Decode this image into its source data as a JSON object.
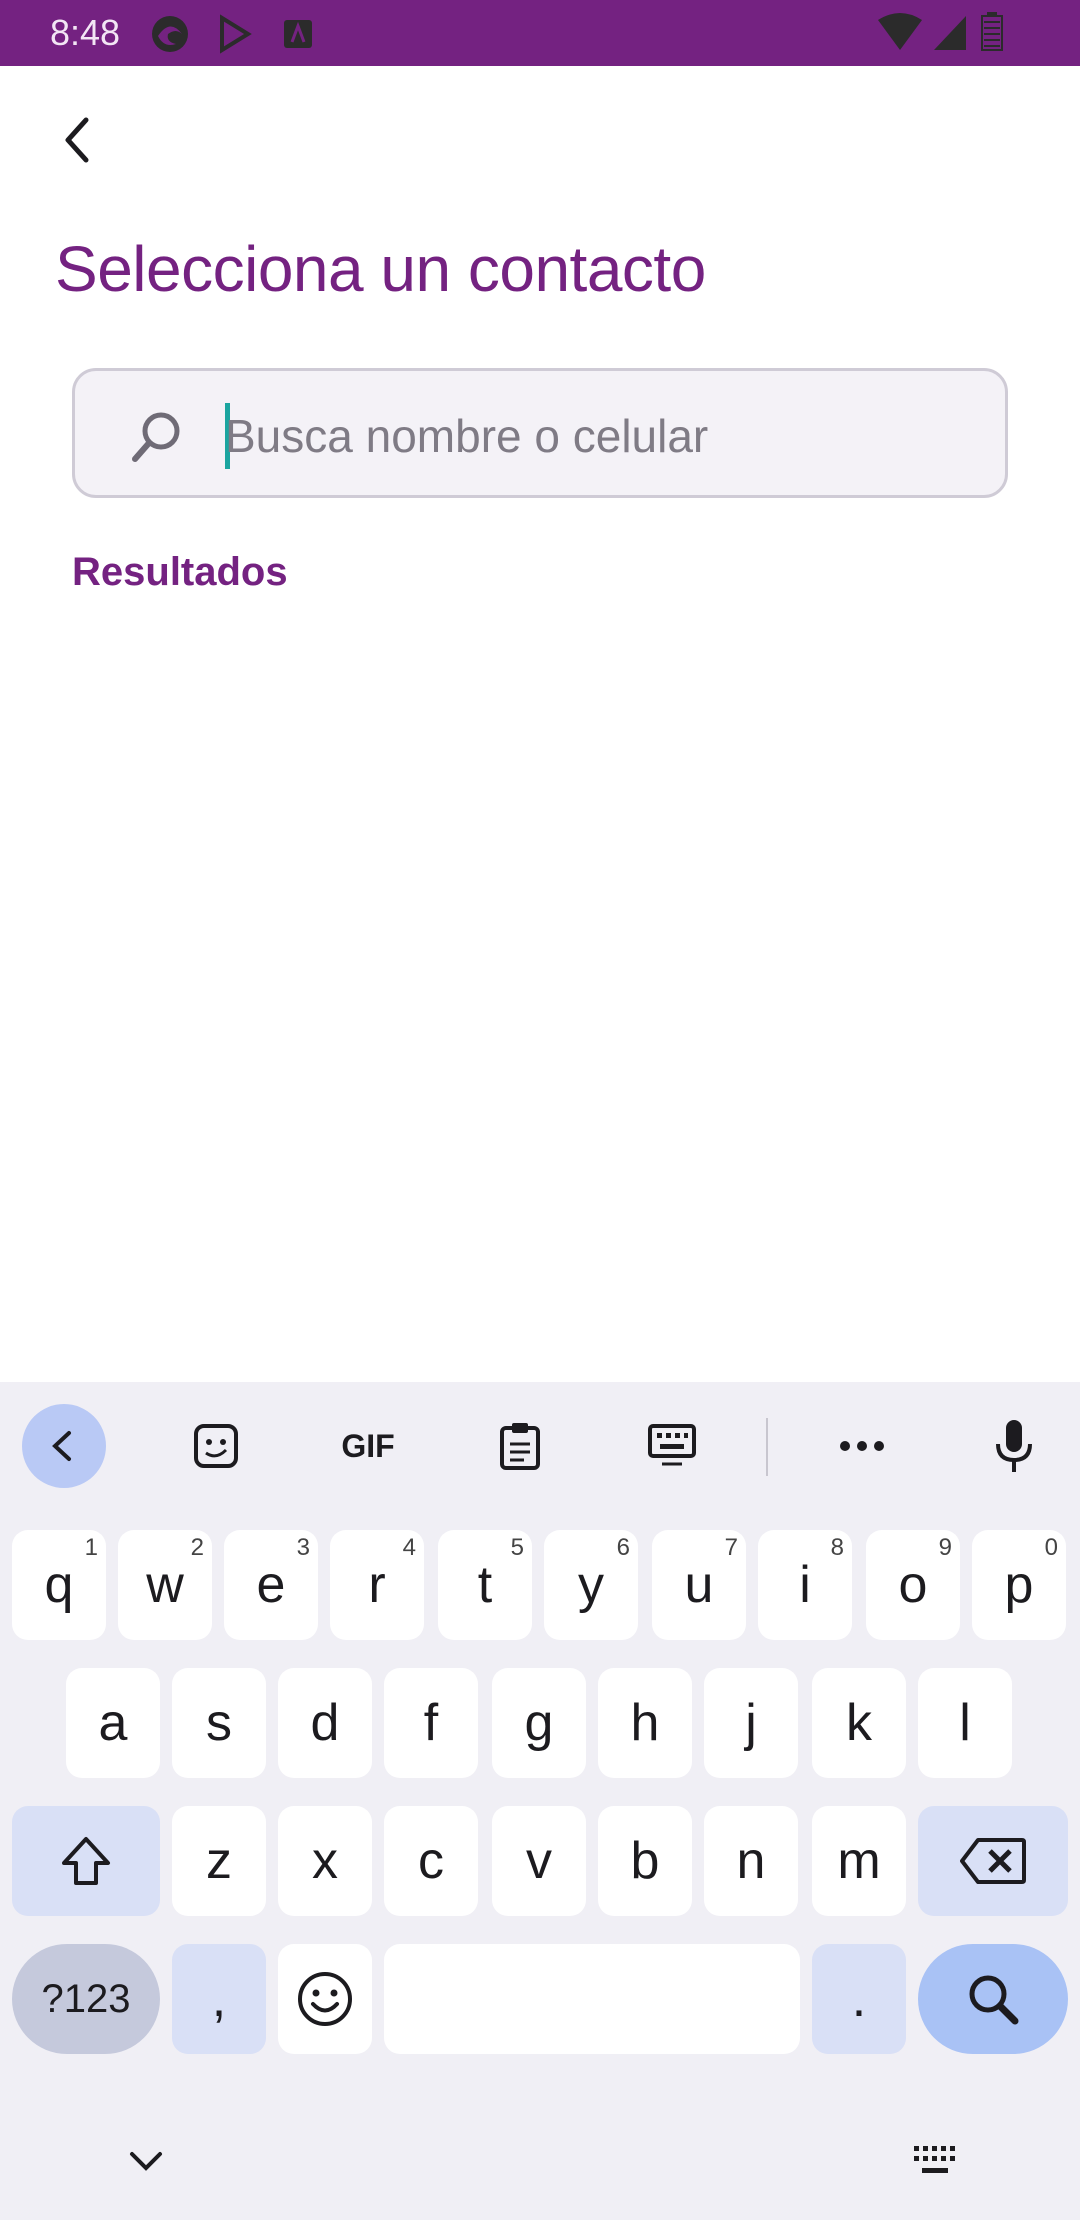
{
  "status_bar": {
    "time": "8:48",
    "icons_left": [
      "edge-icon",
      "play-store-icon",
      "app-icon"
    ],
    "icons_right": [
      "wifi-icon",
      "signal-icon",
      "battery-icon"
    ],
    "background": "#742281"
  },
  "header": {
    "back_icon": "chevron-left-icon",
    "title": "Selecciona un contacto"
  },
  "search": {
    "placeholder": "Busca nombre o celular",
    "value": "",
    "icon": "search-icon"
  },
  "results": {
    "label": "Resultados",
    "items": []
  },
  "keyboard": {
    "toolbar": [
      "back-arrow-icon",
      "sticker-icon",
      "gif-icon",
      "clipboard-icon",
      "keyboard-icon",
      "more-icon",
      "mic-icon"
    ],
    "row1": [
      {
        "label": "q",
        "hint": "1"
      },
      {
        "label": "w",
        "hint": "2"
      },
      {
        "label": "e",
        "hint": "3"
      },
      {
        "label": "r",
        "hint": "4"
      },
      {
        "label": "t",
        "hint": "5"
      },
      {
        "label": "y",
        "hint": "6"
      },
      {
        "label": "u",
        "hint": "7"
      },
      {
        "label": "i",
        "hint": "8"
      },
      {
        "label": "o",
        "hint": "9"
      },
      {
        "label": "p",
        "hint": "0"
      }
    ],
    "row2": [
      "a",
      "s",
      "d",
      "f",
      "g",
      "h",
      "j",
      "k",
      "l"
    ],
    "row3": [
      "z",
      "x",
      "c",
      "v",
      "b",
      "n",
      "m"
    ],
    "row4": {
      "symbols": "?123",
      "comma": ",",
      "period": "."
    },
    "accent": "#742281"
  }
}
